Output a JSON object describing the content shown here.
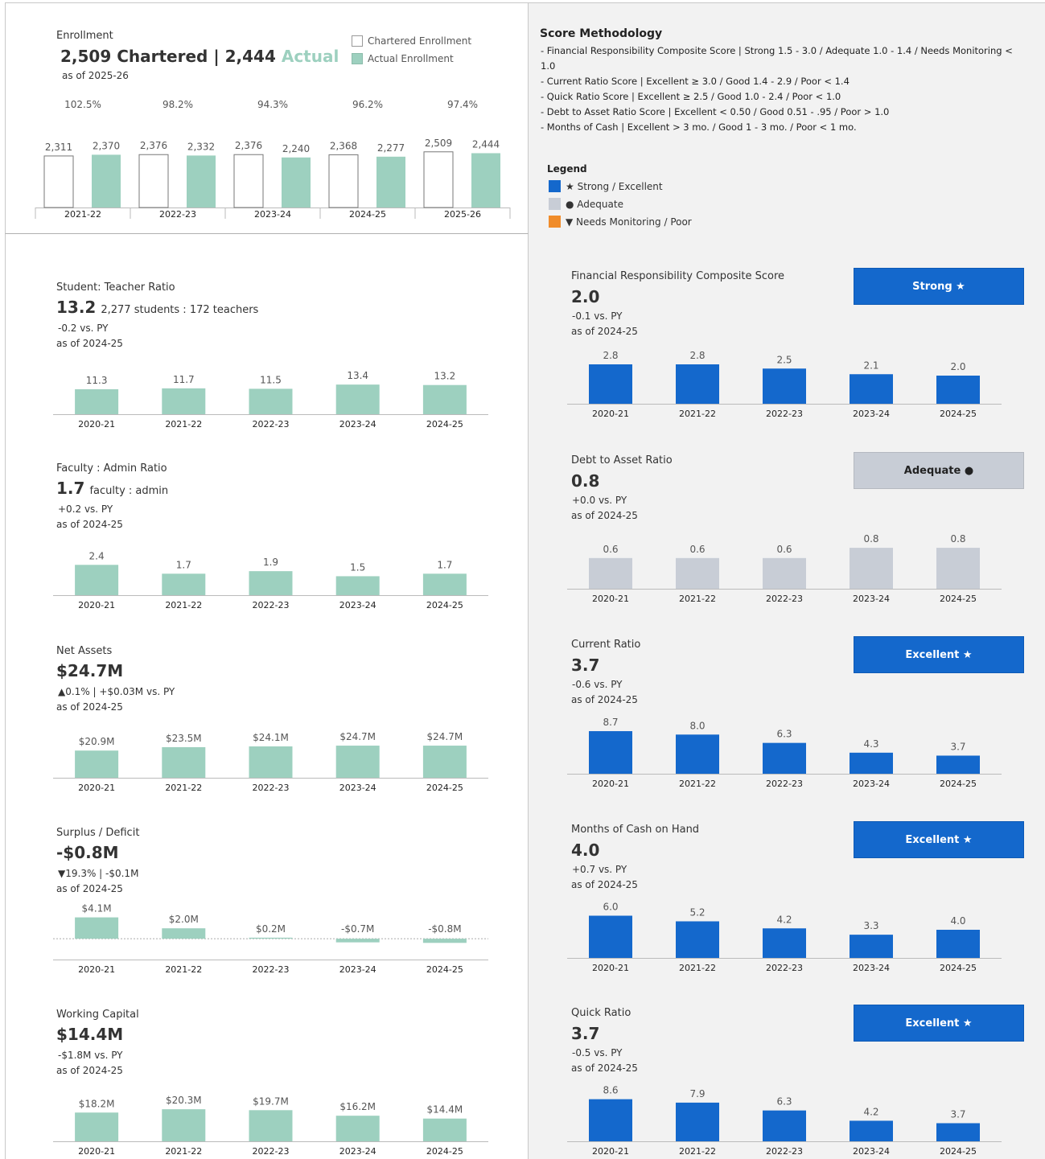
{
  "enrollment": {
    "title": "Enrollment",
    "headline_chartered": "2,509 Chartered | 2,444",
    "headline_actual": "Actual",
    "asof": "as of 2025-26",
    "legend_chartered": "Chartered Enrollment",
    "legend_actual": "Actual Enrollment",
    "colors": {
      "chartered": "#ffffff",
      "actual": "#9dd0bf"
    }
  },
  "left_cards": [
    {
      "title": "Student: Teacher Ratio",
      "value": "13.2",
      "value_suffix": "2,277 students : 172 teachers",
      "change": "-0.2 vs. PY",
      "asof": "as of 2024-25"
    },
    {
      "title": "Faculty : Admin Ratio",
      "value": "1.7",
      "value_suffix": "faculty : admin",
      "change": "+0.2 vs. PY",
      "asof": "as of 2024-25"
    },
    {
      "title": "Net Assets",
      "value": "$24.7M",
      "value_suffix": "",
      "change": "▲0.1% | +$0.03M vs. PY",
      "asof": "as of 2024-25"
    },
    {
      "title": "Surplus / Deficit",
      "value": "-$0.8M",
      "value_suffix": "",
      "change": "▼19.3% | -$0.1M",
      "asof": "as of 2024-25"
    },
    {
      "title": "Working Capital",
      "value": "$14.4M",
      "value_suffix": "",
      "change": "-$1.8M vs. PY",
      "asof": "as of 2024-25"
    }
  ],
  "methodology": {
    "title": "Score Methodology",
    "lines": [
      "- Financial Responsibility Composite Score | Strong 1.5 - 3.0 / Adequate 1.0 - 1.4 / Needs Monitoring <",
      "1.0",
      "- Current Ratio Score | Excellent ≥ 3.0 / Good 1.4 - 2.9 / Poor < 1.4",
      "- Quick Ratio Score | Excellent ≥ 2.5 / Good 1.0 - 2.4 / Poor < 1.0",
      "- Debt to Asset Ratio Score | Excellent < 0.50 / Good 0.51 - .95 / Poor > 1.0",
      "- Months of Cash | Excellent > 3 mo. / Good 1 - 3 mo. / Poor < 1 mo."
    ]
  },
  "legend": {
    "title": "Legend",
    "items": [
      {
        "label": "★ Strong / Excellent",
        "color": "#1468cc"
      },
      {
        "label": "● Adequate",
        "color": "#c8cdd6"
      },
      {
        "label": "▼ Needs Monitoring / Poor",
        "color": "#f08c2a"
      }
    ]
  },
  "right_cards": [
    {
      "title": "Financial Responsibility Composite Score",
      "value": "2.0",
      "change": "-0.1 vs. PY",
      "asof": "as of 2024-25",
      "badge": "Strong ★",
      "badge_type": "strong"
    },
    {
      "title": "Debt to Asset Ratio",
      "value": "0.8",
      "change": "+0.0 vs. PY",
      "asof": "as of 2024-25",
      "badge": "Adequate ●",
      "badge_type": "adequate"
    },
    {
      "title": "Current Ratio",
      "value": "3.7",
      "change": "-0.6 vs. PY",
      "asof": "as of 2024-25",
      "badge": "Excellent ★",
      "badge_type": "strong"
    },
    {
      "title": "Months of Cash on Hand",
      "value": "4.0",
      "change": "+0.7 vs. PY",
      "asof": "as of 2024-25",
      "badge": "Excellent ★",
      "badge_type": "strong"
    },
    {
      "title": "Quick Ratio",
      "value": "3.7",
      "change": "-0.5 vs. PY",
      "asof": "as of 2024-25",
      "badge": "Excellent ★",
      "badge_type": "strong"
    }
  ],
  "chart_data": [
    {
      "id": "enrollment",
      "type": "bar",
      "categories": [
        "2021-22",
        "2022-23",
        "2023-24",
        "2024-25",
        "2025-26"
      ],
      "series": [
        {
          "name": "Chartered Enrollment",
          "values": [
            2311,
            2376,
            2376,
            2368,
            2509
          ],
          "labels": [
            "2,311",
            "2,376",
            "2,376",
            "2,368",
            "2,509"
          ]
        },
        {
          "name": "Actual Enrollment",
          "values": [
            2370,
            2332,
            2240,
            2277,
            2444
          ],
          "labels": [
            "2,370",
            "2,332",
            "2,240",
            "2,277",
            "2,444"
          ]
        }
      ],
      "pct_labels": [
        "102.5%",
        "98.2%",
        "94.3%",
        "96.2%",
        "97.4%"
      ],
      "color": "#9dd0bf"
    },
    {
      "id": "student_teacher",
      "type": "bar",
      "categories": [
        "2020-21",
        "2021-22",
        "2022-23",
        "2023-24",
        "2024-25"
      ],
      "values": [
        11.3,
        11.7,
        11.5,
        13.4,
        13.2
      ],
      "labels": [
        "11.3",
        "11.7",
        "11.5",
        "13.4",
        "13.2"
      ],
      "color": "#9dd0bf",
      "ylim": [
        0,
        20
      ]
    },
    {
      "id": "faculty_admin",
      "type": "bar",
      "categories": [
        "2020-21",
        "2021-22",
        "2022-23",
        "2023-24",
        "2024-25"
      ],
      "values": [
        2.4,
        1.7,
        1.9,
        1.5,
        1.7
      ],
      "labels": [
        "2.4",
        "1.7",
        "1.9",
        "1.5",
        "1.7"
      ],
      "color": "#9dd0bf",
      "ylim": [
        0,
        3.5
      ]
    },
    {
      "id": "net_assets",
      "type": "bar",
      "categories": [
        "2020-21",
        "2021-22",
        "2022-23",
        "2023-24",
        "2024-25"
      ],
      "values": [
        20.9,
        23.5,
        24.1,
        24.7,
        24.7
      ],
      "labels": [
        "$20.9M",
        "$23.5M",
        "$24.1M",
        "$24.7M",
        "$24.7M"
      ],
      "color": "#9dd0bf",
      "ylim": [
        0,
        34
      ]
    },
    {
      "id": "surplus_deficit",
      "type": "bar",
      "categories": [
        "2020-21",
        "2021-22",
        "2022-23",
        "2023-24",
        "2024-25"
      ],
      "values": [
        4.1,
        2.0,
        0.2,
        -0.7,
        -0.8
      ],
      "labels": [
        "$4.1M",
        "$2.0M",
        "$0.2M",
        "-$0.7M",
        "-$0.8M"
      ],
      "color": "#9dd0bf",
      "ylim": [
        -4,
        4.5
      ]
    },
    {
      "id": "working_capital",
      "type": "bar",
      "categories": [
        "2020-21",
        "2021-22",
        "2022-23",
        "2023-24",
        "2024-25"
      ],
      "values": [
        18.2,
        20.3,
        19.7,
        16.2,
        14.4
      ],
      "labels": [
        "$18.2M",
        "$20.3M",
        "$19.7M",
        "$16.2M",
        "$14.4M"
      ],
      "color": "#9dd0bf",
      "ylim": [
        0,
        28
      ]
    },
    {
      "id": "frcs",
      "type": "bar",
      "categories": [
        "2020-21",
        "2021-22",
        "2022-23",
        "2023-24",
        "2024-25"
      ],
      "values": [
        2.8,
        2.8,
        2.5,
        2.1,
        2.0
      ],
      "labels": [
        "2.8",
        "2.8",
        "2.5",
        "2.1",
        "2.0"
      ],
      "color": "#1468cc",
      "ylim": [
        0,
        4
      ]
    },
    {
      "id": "debt_asset",
      "type": "bar",
      "categories": [
        "2020-21",
        "2021-22",
        "2022-23",
        "2023-24",
        "2024-25"
      ],
      "values": [
        0.6,
        0.6,
        0.6,
        0.8,
        0.8
      ],
      "labels": [
        "0.6",
        "0.6",
        "0.6",
        "0.8",
        "0.8"
      ],
      "color": "#c8cdd6",
      "ylim": [
        0,
        1.1
      ]
    },
    {
      "id": "current_ratio",
      "type": "bar",
      "categories": [
        "2020-21",
        "2021-22",
        "2022-23",
        "2023-24",
        "2024-25"
      ],
      "values": [
        8.7,
        8.0,
        6.3,
        4.3,
        3.7
      ],
      "labels": [
        "8.7",
        "8.0",
        "6.3",
        "4.3",
        "3.7"
      ],
      "color": "#1468cc",
      "ylim": [
        0,
        11.5
      ]
    },
    {
      "id": "months_cash",
      "type": "bar",
      "categories": [
        "2020-21",
        "2021-22",
        "2022-23",
        "2023-24",
        "2024-25"
      ],
      "values": [
        6.0,
        5.2,
        4.2,
        3.3,
        4.0
      ],
      "labels": [
        "6.0",
        "5.2",
        "4.2",
        "3.3",
        "4.0"
      ],
      "color": "#1468cc",
      "ylim": [
        0,
        8
      ]
    },
    {
      "id": "quick_ratio",
      "type": "bar",
      "categories": [
        "2020-21",
        "2021-22",
        "2022-23",
        "2023-24",
        "2024-25"
      ],
      "values": [
        8.6,
        7.9,
        6.3,
        4.2,
        3.7
      ],
      "labels": [
        "8.6",
        "7.9",
        "6.3",
        "4.2",
        "3.7"
      ],
      "color": "#1468cc",
      "ylim": [
        0,
        11.5
      ]
    }
  ]
}
